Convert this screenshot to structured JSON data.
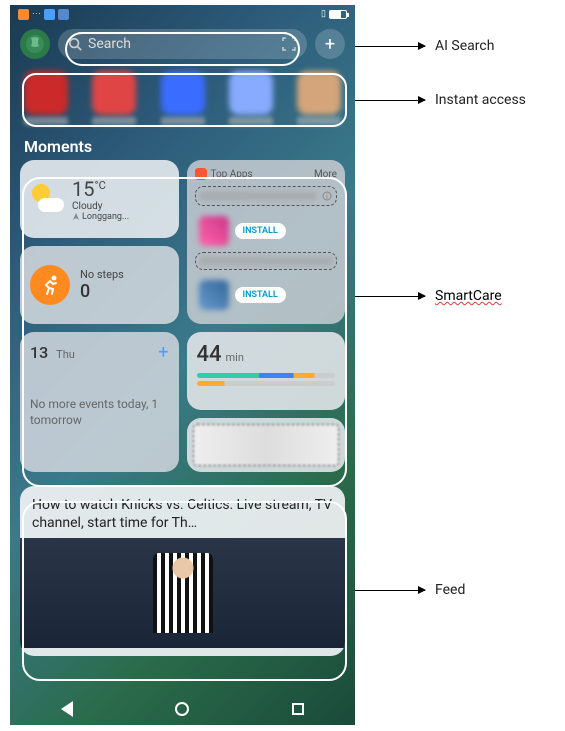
{
  "statusbar": {
    "vibrate_icon": "▢"
  },
  "search": {
    "placeholder": "Search"
  },
  "section": {
    "moments": "Moments"
  },
  "weather": {
    "temp_value": "15",
    "temp_unit": "°C",
    "condition": "Cloudy",
    "location": "Longgang..."
  },
  "steps": {
    "label": "No steps",
    "count": "0"
  },
  "topapps": {
    "title": "Top Apps",
    "more": "More",
    "install": "INSTALL"
  },
  "calendar": {
    "date_num": "13",
    "day": "Thu",
    "body": "No more events today, 1 tomorrow"
  },
  "screentime": {
    "value": "44",
    "unit": "min"
  },
  "feed": {
    "headline": "How to watch Knicks vs. Celtics: Live stream, TV channel, start time for Th…"
  },
  "annotations": {
    "ai_search": "AI Search",
    "instant_access": "Instant access",
    "smartcare": "SmartCare",
    "feed": "Feed"
  }
}
